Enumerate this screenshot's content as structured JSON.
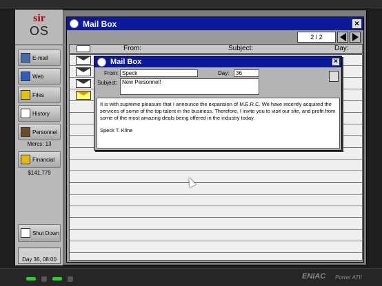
{
  "sidebar": {
    "logo_top": "sir",
    "logo_bottom": "OS",
    "items": [
      {
        "label": "E-mail",
        "icon": "mail-icon"
      },
      {
        "label": "Web",
        "icon": "globe-icon"
      },
      {
        "label": "Files",
        "icon": "folder-icon"
      },
      {
        "label": "History",
        "icon": "book-icon"
      },
      {
        "label": "Personnel",
        "icon": "person-icon",
        "info": "Mercs: 13"
      },
      {
        "label": "Financial",
        "icon": "dollar-icon",
        "info": "$141,779"
      }
    ],
    "shutdown_label": "Shut Down",
    "status_text": "Day 36, 08:00"
  },
  "mailbox": {
    "title": "Mail Box",
    "page": "2 / 2",
    "columns": {
      "from": "From:",
      "subject": "Subject:",
      "day": "Day:"
    }
  },
  "message": {
    "title": "Mail Box",
    "from_label": "From:",
    "from_value": "Speck",
    "day_label": "Day:",
    "day_value": "36",
    "subject_label": "Subject:",
    "subject_value": "New Personnel!",
    "body": "It is with supreme pleasure that I announce the expansion of M.E.R.C. We have recently acquired the services of some of the top talent in the business. Therefore, I invite you to visit our site, and profit from some of the most amazing deals being offered in the industry today.",
    "signature": "Speck T. Kline"
  },
  "bezel": {
    "brand": "ENIAC",
    "model": "Power ATII"
  },
  "colors": {
    "titlebar": "#0a1a9a",
    "sidebar": "#b9b9b9"
  }
}
